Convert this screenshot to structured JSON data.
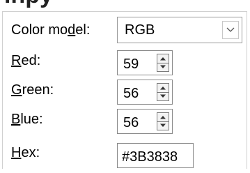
{
  "header": {
    "title_partial": "lnpy"
  },
  "color_model": {
    "label_prefix": "Color mo",
    "label_mnemonic": "d",
    "label_suffix": "el:",
    "value": "RGB"
  },
  "red": {
    "label_mnemonic": "R",
    "label_suffix": "ed:",
    "value": "59"
  },
  "green": {
    "label_mnemonic": "G",
    "label_suffix": "reen:",
    "value": "56"
  },
  "blue": {
    "label_mnemonic": "B",
    "label_suffix": "lue:",
    "value": "56"
  },
  "hex": {
    "label_mnemonic": "H",
    "label_suffix": "ex:",
    "value": "#3B3838"
  },
  "colors": {
    "border": "#8a8a8a",
    "spin_button_bg": "#f3f3f3"
  },
  "icons": {
    "combo_arrow": "chevron-down-icon",
    "spin_up": "triangle-up-icon",
    "spin_down": "triangle-down-icon"
  }
}
